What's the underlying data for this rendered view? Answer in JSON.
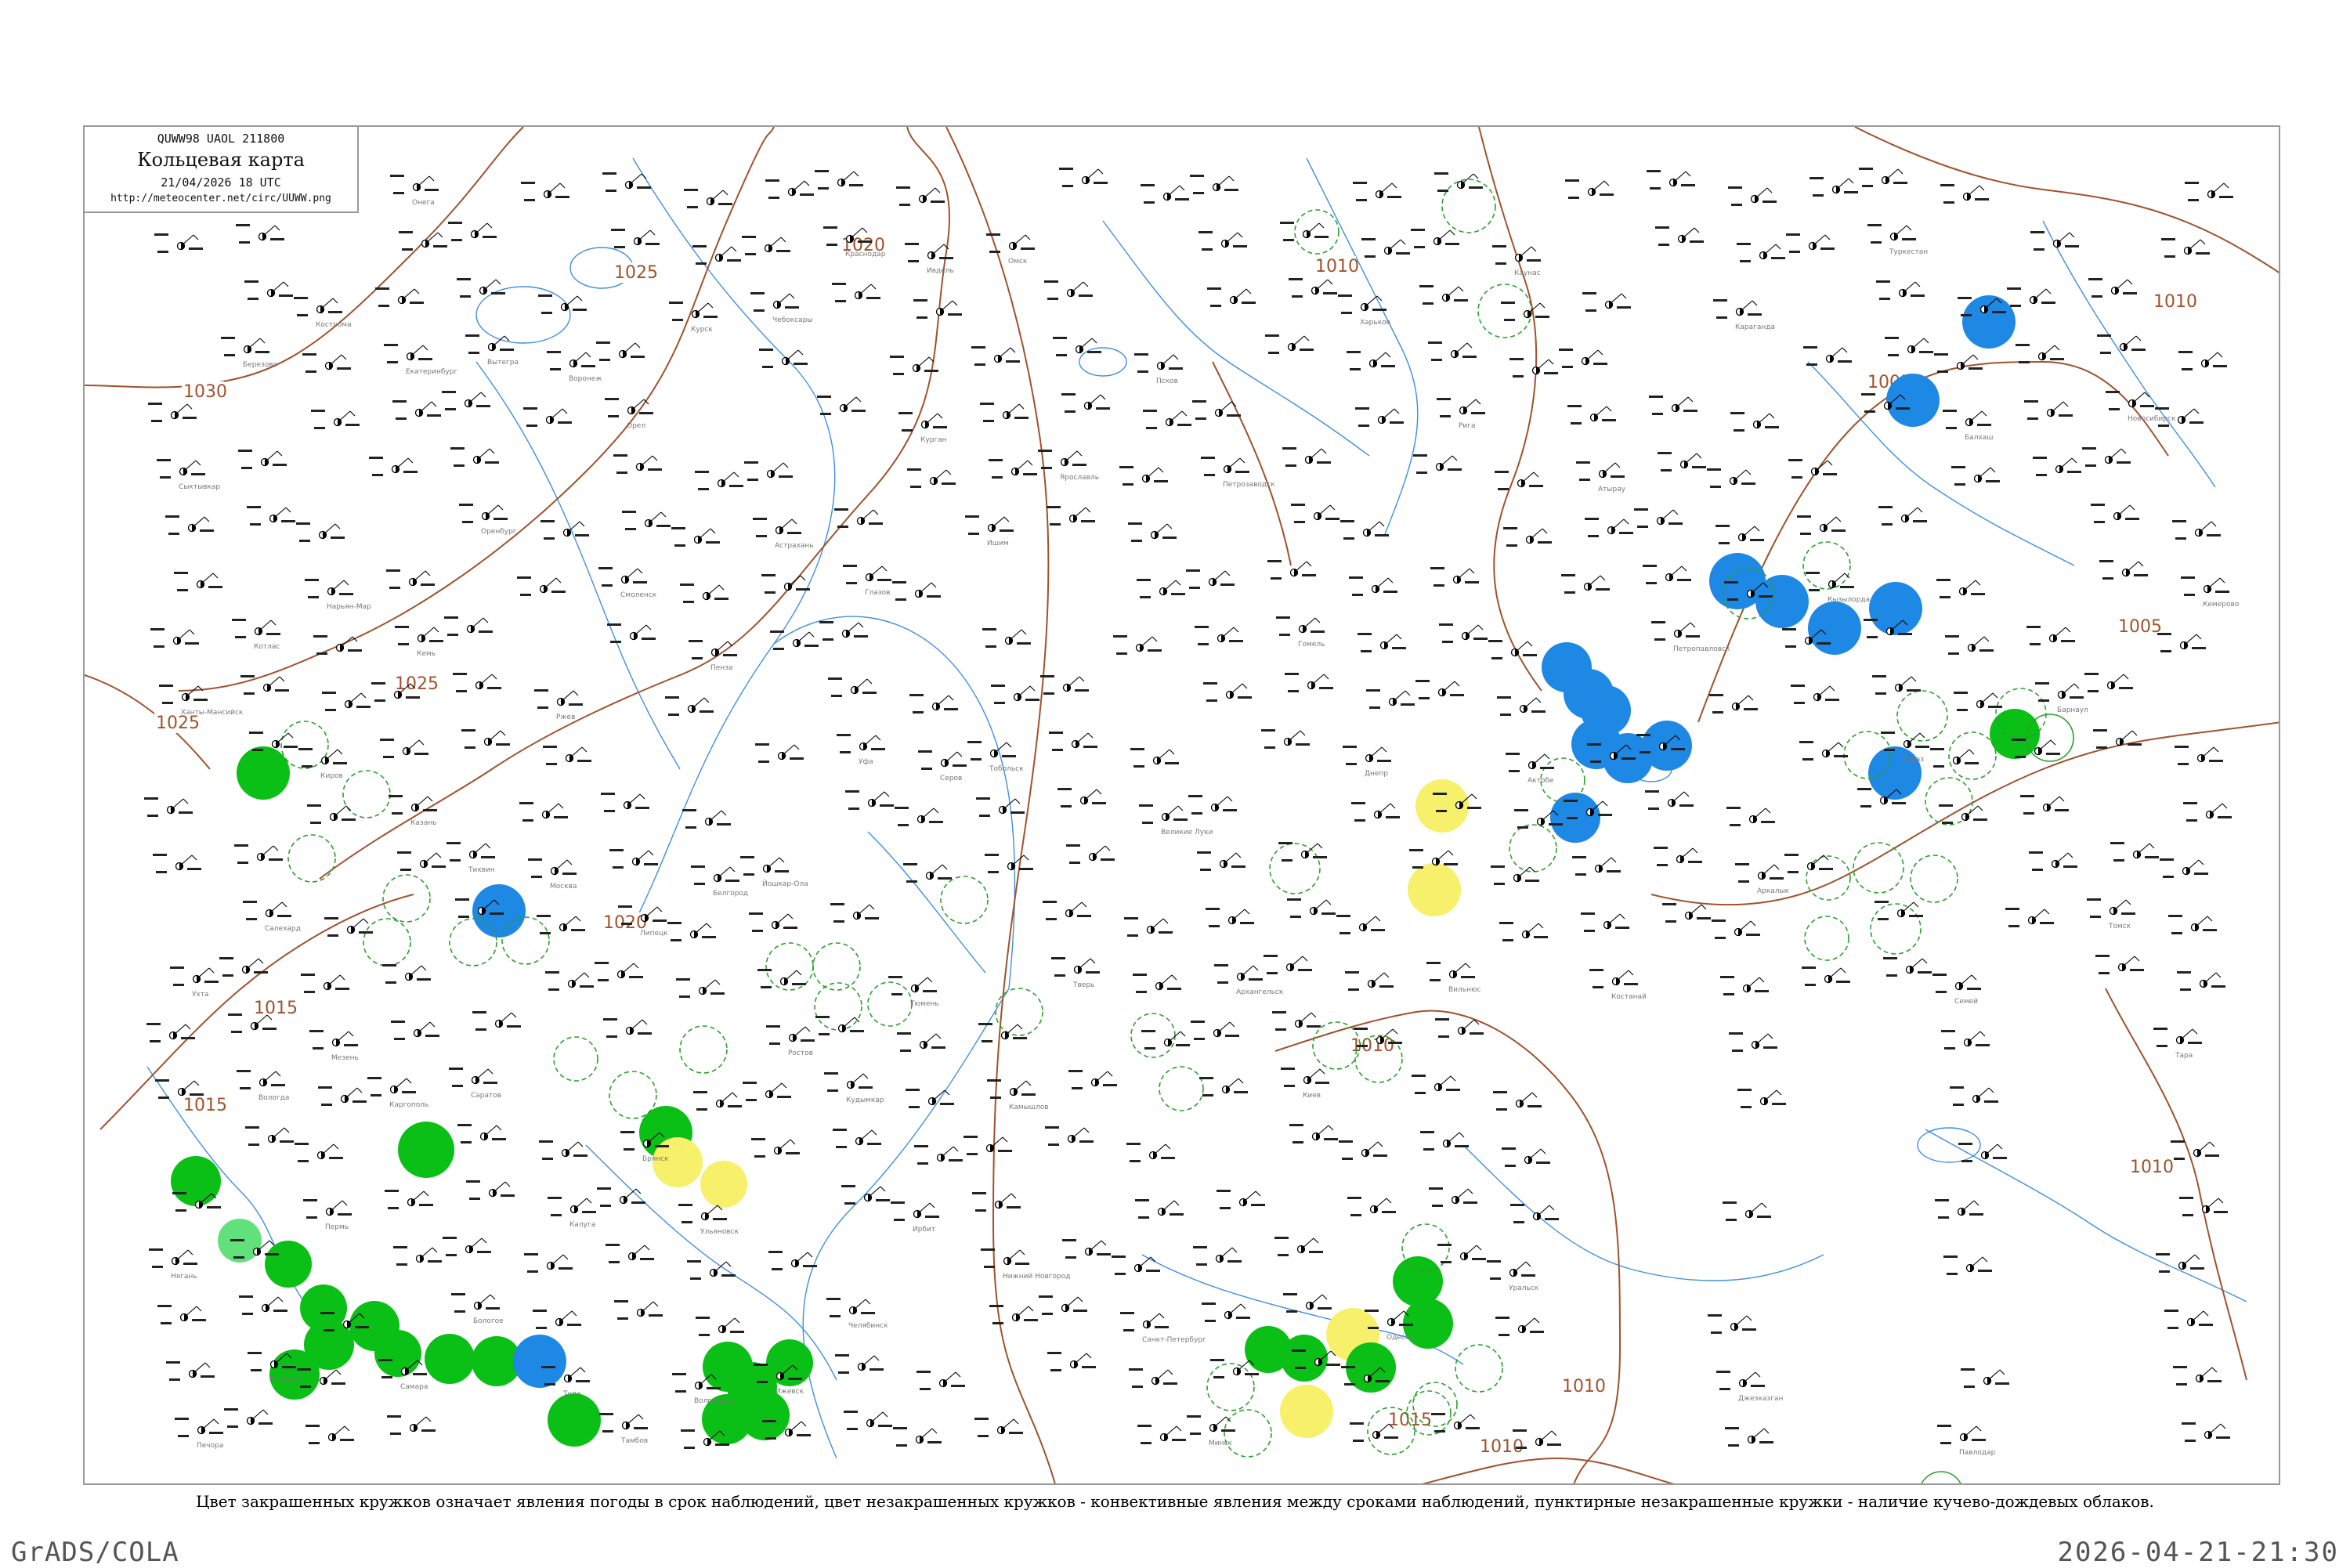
{
  "header": {
    "code": "QUWW98  UAOL  211800",
    "title": "Кольцевая карта",
    "date": "21/04/2026 18 UTC",
    "url": "http://meteocenter.net/circ/UUWW.png"
  },
  "isobars": {
    "labels": [
      "1030",
      "1025",
      "1020",
      "1025",
      "1025",
      "1020",
      "1015",
      "1015",
      "1010",
      "1010",
      "1010",
      "1010",
      "1005",
      "1005",
      "1010",
      "1015",
      "1010"
    ]
  },
  "colors": {
    "isobar": "#a0522d",
    "water": "#3f8fe0",
    "green": "#0abf16",
    "blue": "#1e88e5",
    "yellow": "#f7f06a",
    "light_green": "#61e07c",
    "convective_ring": "#2ca02c",
    "frame": "#9a9a9a"
  },
  "stations": {
    "labels": [
      "Сыктывкар",
      "Ухта",
      "Печора",
      "Котлас",
      "Вологда",
      "Кострома",
      "Киров",
      "Пермь",
      "Екатеринбург",
      "Казань",
      "Самара",
      "Оренбург",
      "Саратов",
      "Воронеж",
      "Москва",
      "Тула",
      "Смоленск",
      "Брянск",
      "Курск",
      "Белгород",
      "Волгоград",
      "Астрахань",
      "Ростов",
      "Краснодар",
      "Уфа",
      "Челябинск",
      "Курган",
      "Тюмень",
      "Омск",
      "Тобольск",
      "Нижний Новгород",
      "Ярославль",
      "Тверь",
      "Псков",
      "Великие Луки",
      "Санкт-Петербург",
      "Петрозаводск",
      "Архангельск",
      "Минск",
      "Гомель",
      "Киев",
      "Харьков",
      "Днепр",
      "Одесса",
      "Рига",
      "Вильнюс",
      "Каунас",
      "Актобе",
      "Уральск",
      "Атырау",
      "Костанай",
      "Петропавловск",
      "Караганда",
      "Аркалык",
      "Джезказган",
      "Кызылорда",
      "Туркестан",
      "Тараз",
      "Балхаш",
      "Семей",
      "Павлодар",
      "Барнаул",
      "Новосибирск",
      "Томск",
      "Кемерово",
      "Тара",
      "Сургут",
      "Ханты-Мансийск",
      "Нягань",
      "Березово",
      "Салехард",
      "Воркута",
      "Нарьян-Мар",
      "Мезень",
      "Онега",
      "Кемь",
      "Каргополь",
      "Вытегра",
      "Тихвин",
      "Бологое",
      "Ржев",
      "Калуга",
      "Орел",
      "Липецк",
      "Тамбов",
      "Пенза",
      "Ульяновск",
      "Чебоксары",
      "Йошкар-Ола",
      "Ижевск",
      "Глазов",
      "Кудымкар",
      "Ивдель",
      "Серов",
      "Ирбит",
      "Ишим",
      "Камышлов"
    ]
  },
  "caption": "Цвет закрашенных кружков означает явления погоды в срок наблюдений, цвет незакрашенных кружков - конвективные явления между сроками наблюдений, пунктирные незакрашенные кружки - наличие кучево-дождевых облаков.",
  "footer": {
    "left": "GrADS/COLA",
    "right": "2026-04-21-21:30"
  }
}
